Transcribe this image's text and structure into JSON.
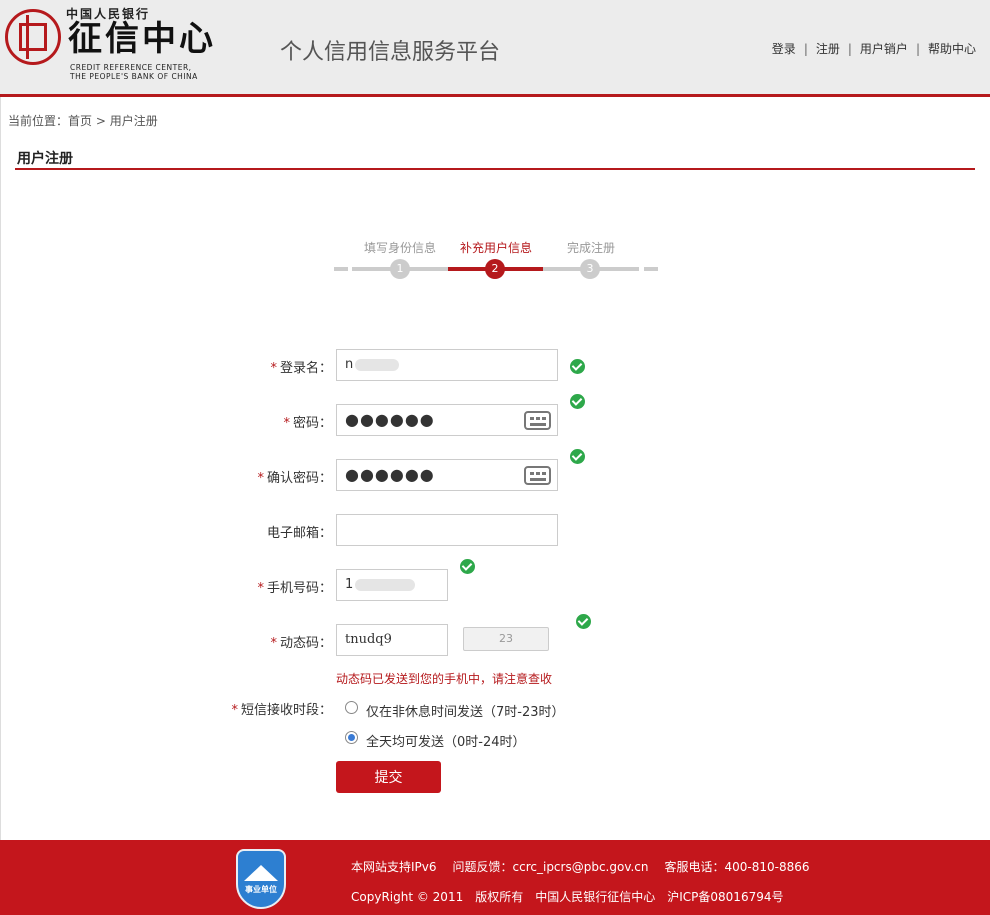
{
  "colors": {
    "brand_red": "#b5191c",
    "button_red": "#c4161c",
    "ok_green": "#2ea84a",
    "radio_blue": "#3a7bd5"
  },
  "header": {
    "logo_top": "中国人民银行",
    "logo_main": "征信中心",
    "logo_en_line1": "CREDIT REFERENCE CENTER,",
    "logo_en_line2": "THE PEOPLE'S BANK OF CHINA",
    "platform_title": "个人信用信息服务平台",
    "nav": {
      "login": "登录",
      "register": "注册",
      "cancel": "用户销户",
      "help": "帮助中心",
      "separator": "|"
    }
  },
  "breadcrumb": {
    "prefix": "当前位置：",
    "home": "首页",
    "arrow": ">",
    "current": "用户注册"
  },
  "section_title": "用户注册",
  "steps": [
    {
      "label": "填写身份信息",
      "number": "1",
      "active": false
    },
    {
      "label": "补充用户信息",
      "number": "2",
      "active": true
    },
    {
      "label": "完成注册",
      "number": "3",
      "active": false
    }
  ],
  "form": {
    "required_mark": "*",
    "login_name": {
      "label": "登录名：",
      "value_prefix": "n"
    },
    "password": {
      "label": "密码：",
      "value": "●●●●●●"
    },
    "confirm_password": {
      "label": "确认密码：",
      "value": "●●●●●●"
    },
    "email": {
      "label": "电子邮箱：",
      "value": ""
    },
    "phone": {
      "label": "手机号码：",
      "value_prefix": "1"
    },
    "dynamic_code": {
      "label": "动态码：",
      "value": "tnudq9",
      "countdown": "23"
    },
    "code_hint": "动态码已发送到您的手机中，请注意查收",
    "sms_period": {
      "label": "短信接收时段：",
      "options": [
        {
          "label": "仅在非休息时间发送（7时-23时）",
          "checked": false
        },
        {
          "label": "全天均可发送（0时-24时）",
          "checked": true
        }
      ]
    },
    "submit_label": "提交"
  },
  "footer": {
    "badge_text": "事业单位",
    "line1": [
      "本网站支持IPv6",
      "问题反馈：ccrc_ipcrs@pbc.gov.cn",
      "客服电话：400-810-8866"
    ],
    "line2": [
      "CopyRight © 2011",
      "版权所有",
      "中国人民银行征信中心",
      "沪ICP备08016794号"
    ]
  }
}
